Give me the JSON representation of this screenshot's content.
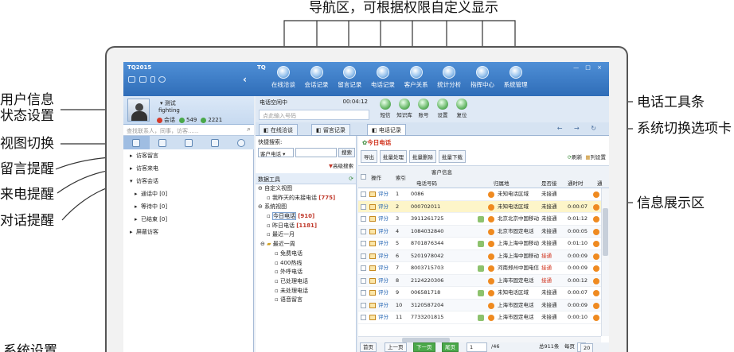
{
  "annotations": {
    "top": "导航区，可根据权限自定义显示",
    "user": "用户信息\n状态设置",
    "view": "视图切换",
    "msg": "留言提醒",
    "call": "来电提醒",
    "chat": "对话提醒",
    "settings": "系统设置",
    "phone_toolbar": "电话工具条",
    "tabs_switch": "系统切换选项卡",
    "info_area": "信息展示区"
  },
  "app": {
    "left_title": "TQ2015",
    "main_title": "TQ",
    "nav": [
      "在线洽谈",
      "会话记录",
      "留言记录",
      "电话记录",
      "客户关系",
      "统计分析",
      "指挥中心",
      "系统管理"
    ],
    "user": {
      "name": "测试",
      "sign": "fighting",
      "status": "会话",
      "count_a": "549",
      "count_b": "2221"
    },
    "search_placeholder": "查找联系人，同事，访客......",
    "tree": [
      "访客留言",
      "访客来电",
      "访客会话",
      "通话中 [0]",
      "等待中 [0]",
      "已结束 [0]",
      "屏蔽访客"
    ],
    "phone": {
      "status": "电话空闲中",
      "time": "00:04:12",
      "placeholder": "点此输入号码"
    },
    "tools": [
      "短信",
      "知识库",
      "账号",
      "设置",
      "复位"
    ],
    "tabs": [
      "在线洽谈",
      "留言记录",
      "电话记录"
    ],
    "filter": {
      "label": "快捷搜索:",
      "select": "客户电话",
      "btn": "搜索",
      "adv": "高级搜索"
    },
    "data_tree": {
      "header": "数据工具",
      "n0": "自定义视图",
      "n1": "我昨天的未接电话",
      "n1c": "[775]",
      "n2": "系统视图",
      "n3": "今日电话",
      "n3c": "[910]",
      "n4": "昨日电话",
      "n4c": "[1181]",
      "n5": "最近一月",
      "n6": "最近一周",
      "n7": "免费电话",
      "n8": "400热线",
      "n9": "外呼电话",
      "n10": "已处理电话",
      "n11": "未处理电话",
      "n12": "语音留言"
    },
    "grid": {
      "title": "今日电话",
      "btns": [
        "导出",
        "批量处理",
        "批量删除",
        "批量下载"
      ],
      "refresh": "刷新",
      "colset": "列设置",
      "h_op": "操作",
      "h_idx": "索引",
      "h_info": "客户信息",
      "h_phone": "电话号码",
      "h_area": "归属地",
      "h_conn": "是否接",
      "h_dur": "通时时",
      "h_more": "通",
      "rows": [
        {
          "i": "1",
          "p": "0086",
          "a": "未知电话区域",
          "s": "未接通",
          "d": ""
        },
        {
          "i": "2",
          "p": "000702011",
          "a": "未知电话区域",
          "s": "未接通",
          "d": "0:00:07"
        },
        {
          "i": "3",
          "p": "3911261725",
          "a": "北京北京中国移动",
          "s": "未接通",
          "d": "0:01:12"
        },
        {
          "i": "4",
          "p": "1084032840",
          "a": "北京市固定电话",
          "s": "未接通",
          "d": "0:00:05"
        },
        {
          "i": "5",
          "p": "8701876344",
          "a": "上海上海中国移动",
          "s": "未接通",
          "d": "0:01:10"
        },
        {
          "i": "6",
          "p": "5201978042",
          "a": "上海上海中国移动",
          "s": "接通",
          "d": "0:00:09"
        },
        {
          "i": "7",
          "p": "8003715703",
          "a": "河南郑州中国电信",
          "s": "接通",
          "d": "0:00:09"
        },
        {
          "i": "8",
          "p": "2124220306",
          "a": "上海市固定电话",
          "s": "接通",
          "d": "0:00:12"
        },
        {
          "i": "9",
          "p": "006581718",
          "a": "未知电话区域",
          "s": "未接通",
          "d": "0:00:07"
        },
        {
          "i": "10",
          "p": "3120587204",
          "a": "上海市固定电话",
          "s": "未接通",
          "d": "0:00:09"
        },
        {
          "i": "11",
          "p": "7733201815",
          "a": "上海市固定电话",
          "s": "未接通",
          "d": "0:00:10"
        }
      ],
      "eval": "评分"
    },
    "pager": {
      "first": "首页",
      "prev": "上一页",
      "next": "下一页",
      "last": "尾页",
      "page": "1",
      "total_pages": "/46",
      "total": "总911条",
      "per": "每页",
      "per_val": "20"
    }
  }
}
